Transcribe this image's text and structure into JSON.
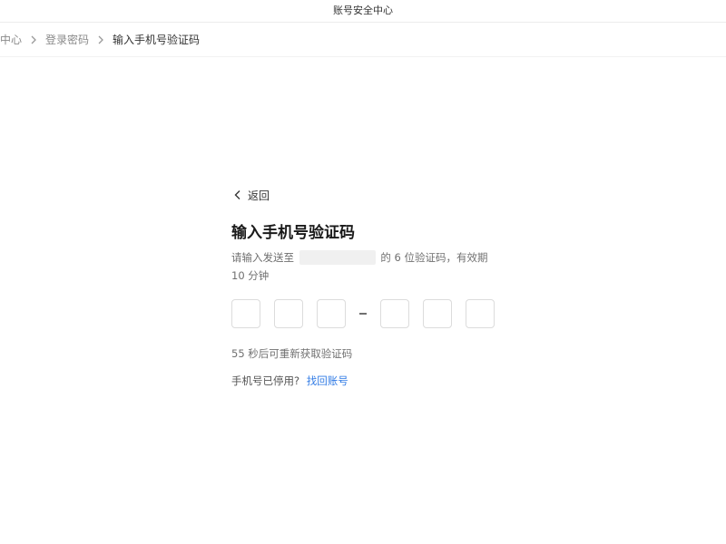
{
  "window": {
    "title": "账号安全中心"
  },
  "breadcrumb": {
    "items": [
      "中心",
      "登录密码",
      "输入手机号验证码"
    ]
  },
  "panel": {
    "back_label": "返回",
    "heading": "输入手机号验证码",
    "description_prefix": "请输入发送至",
    "description_suffix": "的 6 位验证码，有效期 10 分钟",
    "code_digits": [
      "",
      "",
      "",
      "",
      "",
      ""
    ],
    "countdown": "55 秒后可重新获取验证码",
    "recover_prompt": "手机号已停用?",
    "recover_link": "找回账号"
  },
  "colors": {
    "link": "#2f7ae5",
    "box_border": "#dcdcdc",
    "muted_text": "#707070"
  },
  "icons": {
    "back": "chevron-left-icon",
    "breadcrumb_separator": "chevron-right-icon"
  }
}
